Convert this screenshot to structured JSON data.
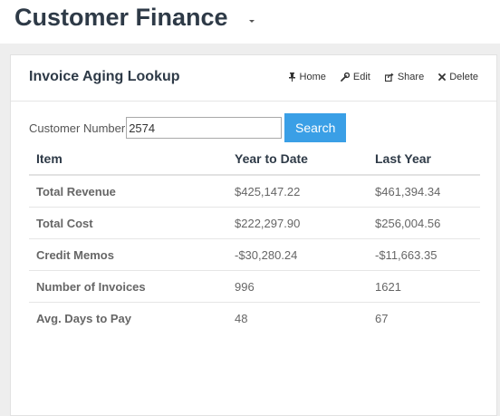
{
  "header": {
    "title": "Customer Finance"
  },
  "panel": {
    "title": "Invoice Aging Lookup",
    "actions": {
      "home": "Home",
      "edit": "Edit",
      "share": "Share",
      "delete": "Delete"
    }
  },
  "search": {
    "label": "Customer Number",
    "value": "2574",
    "button_label": "Search"
  },
  "table": {
    "headers": [
      "Item",
      "Year to Date",
      "Last Year"
    ],
    "rows": [
      [
        "Total Revenue",
        "$425,147.22",
        "$461,394.34"
      ],
      [
        "Total Cost",
        "$222,297.90",
        "$256,004.56"
      ],
      [
        "Credit Memos",
        "-$30,280.24",
        "-$11,663.35"
      ],
      [
        "Number of Invoices",
        "996",
        "1621"
      ],
      [
        "Avg. Days to Pay",
        "48",
        "67"
      ]
    ]
  },
  "icons": {
    "title_dropdown": "chevron-down-icon",
    "home": "pin-icon",
    "edit": "wrench-icon",
    "share": "share-icon",
    "delete": "close-icon"
  },
  "colors": {
    "title_text": "#2e3a47",
    "search_button": "#3a9fe6",
    "page_background": "#eeeeee"
  }
}
